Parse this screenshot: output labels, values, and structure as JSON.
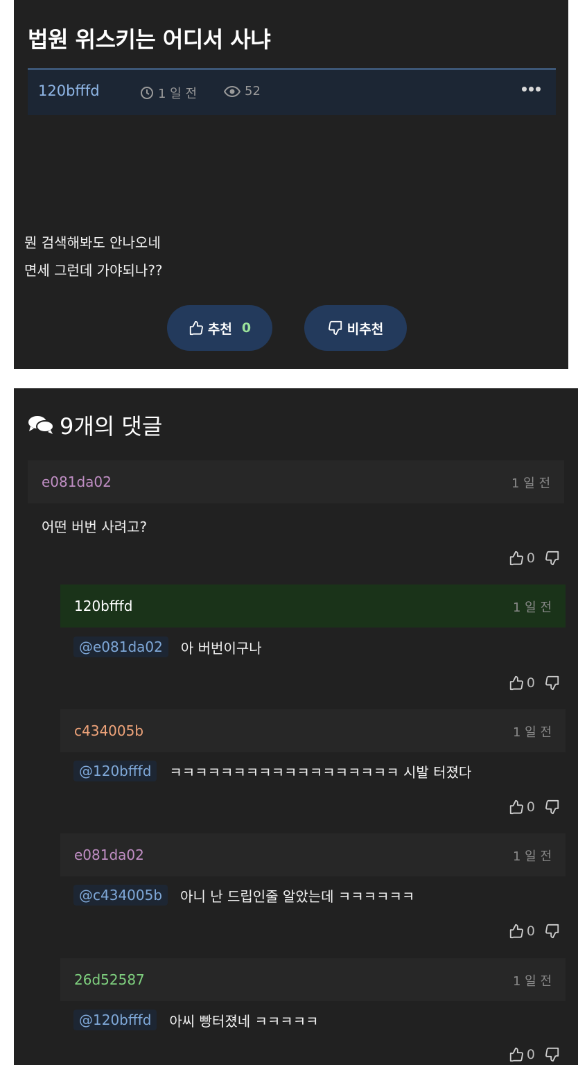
{
  "post": {
    "title": "법원 위스키는 어디서 사냐",
    "author": "120bfffd",
    "time": "1 일 전",
    "views": "52",
    "body_lines": [
      "뭔 검색해봐도 안나오네",
      "면세 그런데 가야되나??"
    ],
    "upvote_label": "추천",
    "upvote_count": "0",
    "downvote_label": "비추천"
  },
  "comments_section": {
    "header": "9개의 댓글",
    "comments": [
      {
        "author": "e081da02",
        "author_color": "#c08ec4",
        "time": "1 일 전",
        "mention": "",
        "text": "어떤 버번 사려고?",
        "upvotes": "0"
      },
      {
        "author": "120bfffd",
        "author_color": "#ffffff",
        "time": "1 일 전",
        "mention": "@e081da02",
        "text": "아 버번이구나",
        "upvotes": "0"
      },
      {
        "author": "c434005b",
        "author_color": "#f0a47a",
        "time": "1 일 전",
        "mention": "@120bfffd",
        "text": "ㅋㅋㅋㅋㅋㅋㅋㅋㅋㅋㅋㅋㅋㅋㅋㅋㅋㅋ 시발 터졌다",
        "upvotes": "0"
      },
      {
        "author": "e081da02",
        "author_color": "#c08ec4",
        "time": "1 일 전",
        "mention": "@c434005b",
        "text": "아니 난 드립인줄 알았는데 ㅋㅋㅋㅋㅋㅋ",
        "upvotes": "0"
      },
      {
        "author": "26d52587",
        "author_color": "#7fd07f",
        "time": "1 일 전",
        "mention": "@120bfffd",
        "text": "아씨 빵터졌네 ㅋㅋㅋㅋㅋ",
        "upvotes": "0"
      }
    ]
  },
  "icons": {
    "clock": "clock-icon",
    "views": "eye-icon",
    "more": "more-dots-icon",
    "thumb_up": "thumbs-up-icon",
    "thumb_down": "thumbs-down-icon",
    "comments": "comments-icon"
  },
  "colors": {
    "background": "#212121",
    "accent_blue": "#8fb6e6",
    "button_bg": "#233a5c",
    "op_highlight": "#1a3319"
  }
}
